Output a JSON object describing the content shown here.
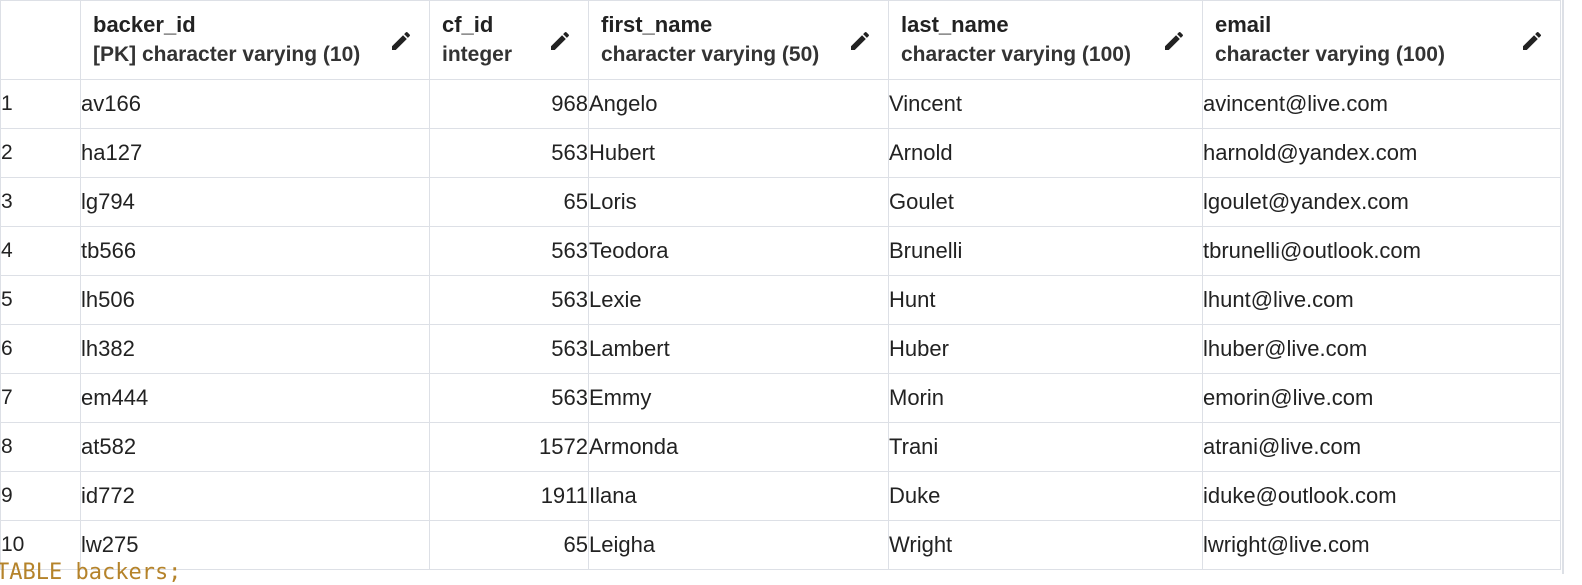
{
  "columns": [
    {
      "name": "backer_id",
      "type": "[PK] character varying (10)"
    },
    {
      "name": "cf_id",
      "type": "integer"
    },
    {
      "name": "first_name",
      "type": "character varying (50)"
    },
    {
      "name": "last_name",
      "type": "character varying (100)"
    },
    {
      "name": "email",
      "type": "character varying (100)"
    }
  ],
  "rows": [
    {
      "n": "1",
      "backer_id": "av166",
      "cf_id": "968",
      "first_name": "Angelo",
      "last_name": "Vincent",
      "email": "avincent@live.com"
    },
    {
      "n": "2",
      "backer_id": "ha127",
      "cf_id": "563",
      "first_name": "Hubert",
      "last_name": "Arnold",
      "email": "harnold@yandex.com"
    },
    {
      "n": "3",
      "backer_id": "lg794",
      "cf_id": "65",
      "first_name": "Loris",
      "last_name": "Goulet",
      "email": "lgoulet@yandex.com"
    },
    {
      "n": "4",
      "backer_id": "tb566",
      "cf_id": "563",
      "first_name": "Teodora",
      "last_name": "Brunelli",
      "email": "tbrunelli@outlook.com"
    },
    {
      "n": "5",
      "backer_id": "lh506",
      "cf_id": "563",
      "first_name": "Lexie",
      "last_name": "Hunt",
      "email": "lhunt@live.com"
    },
    {
      "n": "6",
      "backer_id": "lh382",
      "cf_id": "563",
      "first_name": "Lambert",
      "last_name": "Huber",
      "email": "lhuber@live.com"
    },
    {
      "n": "7",
      "backer_id": "em444",
      "cf_id": "563",
      "first_name": "Emmy",
      "last_name": "Morin",
      "email": "emorin@live.com"
    },
    {
      "n": "8",
      "backer_id": "at582",
      "cf_id": "1572",
      "first_name": "Armonda",
      "last_name": "Trani",
      "email": "atrani@live.com"
    },
    {
      "n": "9",
      "backer_id": "id772",
      "cf_id": "1911",
      "first_name": "Ilana",
      "last_name": "Duke",
      "email": "iduke@outlook.com"
    },
    {
      "n": "10",
      "backer_id": "lw275",
      "cf_id": "65",
      "first_name": "Leigha",
      "last_name": "Wright",
      "email": "lwright@live.com"
    }
  ],
  "background_text": "TABLE backers;",
  "icons": {
    "edit": "pencil-icon"
  },
  "colors": {
    "grid_line": "#dde0e6",
    "background_text": "#b5832a"
  }
}
